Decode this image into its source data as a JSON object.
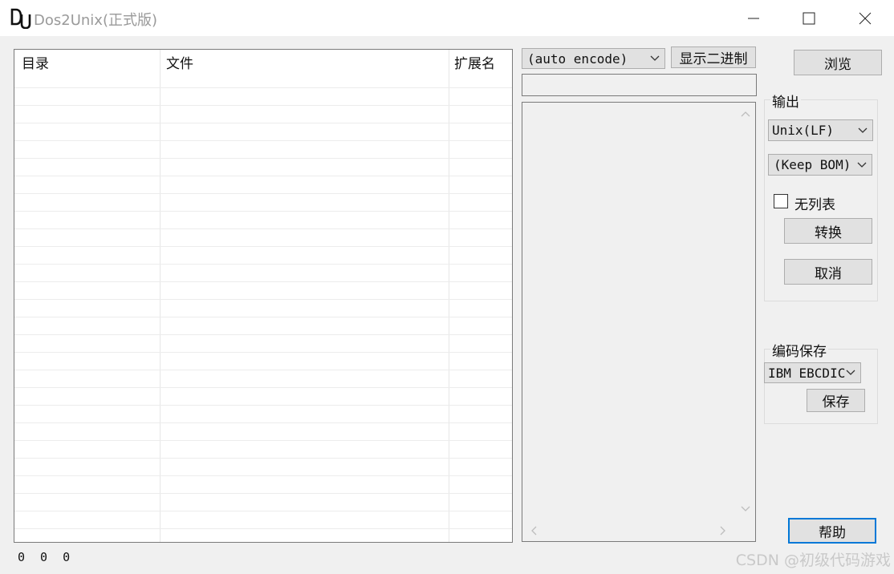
{
  "window": {
    "title": "Dos2Unix(正式版)",
    "logo_text": "DU"
  },
  "file_list": {
    "columns": [
      "目录",
      "文件",
      "扩展名"
    ],
    "rows": []
  },
  "encoding": {
    "selected": "(auto encode)",
    "show_binary_label": "显示二进制",
    "path_value": ""
  },
  "browse_label": "浏览",
  "output": {
    "group_label": "输出",
    "line_ending": "Unix(LF)",
    "bom_option": "(Keep BOM)",
    "no_list_label": "无列表",
    "no_list_checked": false,
    "convert_label": "转换",
    "cancel_label": "取消"
  },
  "encode_save": {
    "group_label": "编码保存",
    "encoding": "IBM EBCDIC",
    "save_label": "保存"
  },
  "help_label": "帮助",
  "status": "0 0 0",
  "watermark": "CSDN @初级代码游戏"
}
